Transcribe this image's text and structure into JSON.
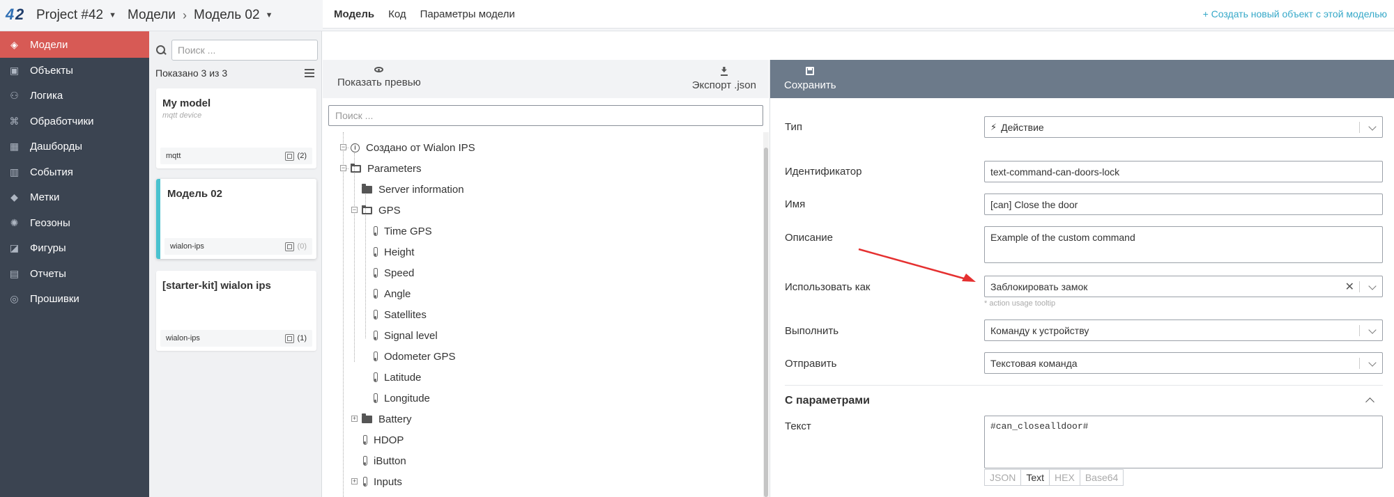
{
  "topbar": {
    "project": "Project #42",
    "models": "Модели",
    "current_model": "Модель 02",
    "help_icon": "question-circle-icon",
    "mail_icon": "envelope-icon",
    "avatar_icon": "user-avatar"
  },
  "sidebar": {
    "items": [
      {
        "label": "Модели",
        "icon": "cube-icon",
        "active": true
      },
      {
        "label": "Объекты",
        "icon": "object-icon"
      },
      {
        "label": "Логика",
        "icon": "logic-icon"
      },
      {
        "label": "Обработчики",
        "icon": "code-icon"
      },
      {
        "label": "Дашборды",
        "icon": "dashboard-icon"
      },
      {
        "label": "События",
        "icon": "events-icon"
      },
      {
        "label": "Метки",
        "icon": "tag-icon"
      },
      {
        "label": "Геозоны",
        "icon": "geozone-icon"
      },
      {
        "label": "Фигуры",
        "icon": "shapes-icon"
      },
      {
        "label": "Отчеты",
        "icon": "report-icon"
      },
      {
        "label": "Прошивки",
        "icon": "firmware-icon"
      }
    ],
    "accent": "#d75a55"
  },
  "list": {
    "search_placeholder": "Поиск ...",
    "shown": "Показано 3 из 3",
    "cards": [
      {
        "title": "My model",
        "subtitle": "mqtt device",
        "type": "mqtt",
        "count": "(2)"
      },
      {
        "title": "Модель 02",
        "subtitle": "",
        "type": "wialon-ips",
        "count": "(0)",
        "selected": true
      },
      {
        "title": "[starter-kit] wialon ips",
        "subtitle": "",
        "type": "wialon-ips",
        "count": "(1)"
      }
    ]
  },
  "tabs": {
    "items": [
      "Модель",
      "Код",
      "Параметры модели"
    ],
    "create_link": "+ Создать новый объект с этой моделью"
  },
  "toolbar": {
    "preview": "Показать превью",
    "export": "Экспорт .json"
  },
  "tree": {
    "search_placeholder": "Поиск ...",
    "nodes": {
      "created": "Создано от Wialon IPS",
      "parameters": "Parameters",
      "server_info": "Server information",
      "gps": "GPS",
      "time_gps": "Time GPS",
      "height": "Height",
      "speed": "Speed",
      "angle": "Angle",
      "satellites": "Satellites",
      "signal": "Signal level",
      "odometer": "Odometer GPS",
      "latitude": "Latitude",
      "longitude": "Longitude",
      "battery": "Battery",
      "hdop": "HDOP",
      "ibutton": "iButton",
      "inputs": "Inputs"
    }
  },
  "form": {
    "save": "Сохранить",
    "type_label": "Тип",
    "type_value": "Действие",
    "id_label": "Идентификатор",
    "id_value": "text-command-can-doors-lock",
    "name_label": "Имя",
    "name_value": "[can] Close the door",
    "desc_label": "Описание",
    "desc_value": "Example of the custom command",
    "use_label": "Использовать как",
    "use_value": "Заблокировать замок",
    "use_hint": "* action usage tooltip",
    "exec_label": "Выполнить",
    "exec_value": "Команду к устройству",
    "send_label": "Отправить",
    "send_value": "Текстовая команда",
    "params_title": "С параметрами",
    "text_label": "Текст",
    "text_value": "#can_closealldoor#",
    "formats": [
      "JSON",
      "Text",
      "HEX",
      "Base64"
    ],
    "active_format": "Text"
  },
  "colors": {
    "sidebar_bg": "#3b4451",
    "save_bar": "#6c7a8a",
    "link": "#35a8c8",
    "selected_stripe": "#4ac2cf",
    "annotation_arrow": "#e53030"
  }
}
